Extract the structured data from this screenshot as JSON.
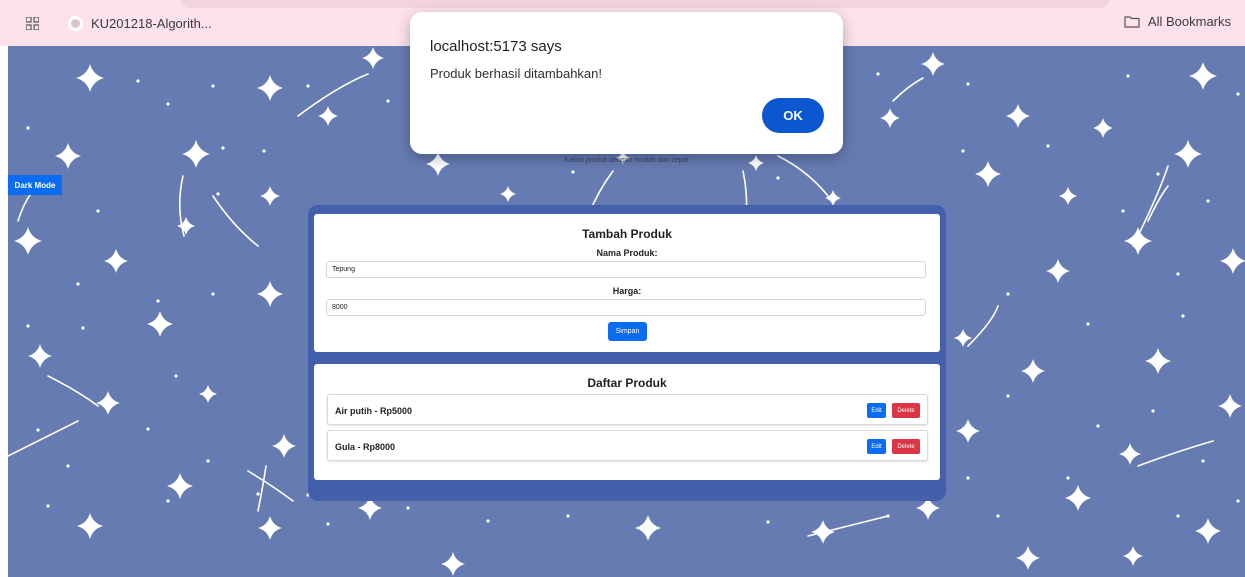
{
  "bookmarks_bar": {
    "apps_icon": "apps-grid-icon",
    "bookmark_item": "KU201218-Algorith...",
    "all_bookmarks": "All Bookmarks",
    "folder_icon": "folder-icon"
  },
  "page": {
    "dark_mode_label": "Dark Mode",
    "subtitle": "Kelola produk dengan mudah dan cepat",
    "form": {
      "heading": "Tambah Produk",
      "name_label": "Nama Produk:",
      "name_value": "Tepung",
      "price_label": "Harga:",
      "price_value": "8000",
      "save_label": "Simpan"
    },
    "list": {
      "heading": "Daftar Produk",
      "edit_label": "Edit",
      "delete_label": "Delete",
      "items": [
        {
          "text": "Air putih - Rp5000"
        },
        {
          "text": "Gula - Rp8000"
        }
      ]
    }
  },
  "dialog": {
    "title": "localhost:5173 says",
    "message": "Produk berhasil ditambahkan!",
    "ok_label": "OK"
  },
  "colors": {
    "bookmarks_bar": "#fde2ea",
    "page_background": "#667bb2",
    "panel": "#4460ab",
    "primary": "#0a6cf0",
    "danger": "#dc3545",
    "dialog_button": "#0b57d0"
  }
}
